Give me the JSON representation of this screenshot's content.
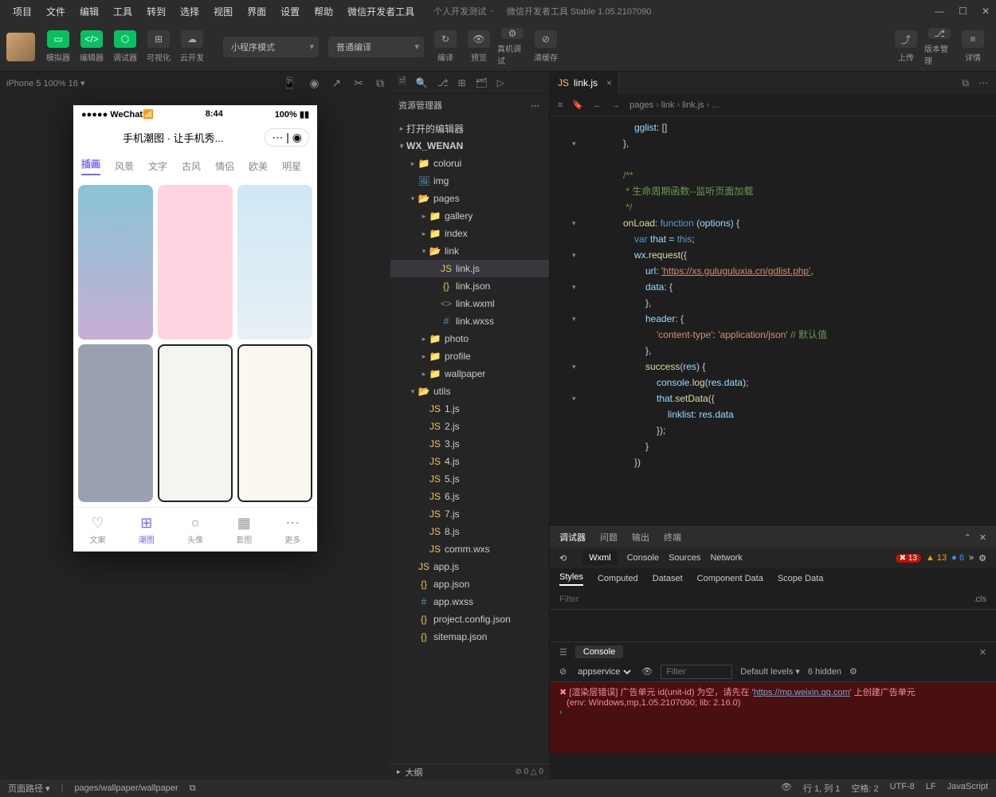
{
  "menu": [
    "项目",
    "文件",
    "编辑",
    "工具",
    "转到",
    "选择",
    "视图",
    "界面",
    "设置",
    "帮助",
    "微信开发者工具"
  ],
  "title": "个人开发测试",
  "title2": "微信开发者工具 Stable 1.05.2107090",
  "toolbar": {
    "sim": "模拟器",
    "editor": "编辑器",
    "debug": "调试器",
    "vis": "可视化",
    "cloud": "云开发",
    "mode": "小程序模式",
    "compile_mode": "普通编译",
    "compile": "编译",
    "preview": "预览",
    "remote": "真机调试",
    "clear": "清缓存",
    "upload": "上传",
    "ver": "版本管理",
    "detail": "详情"
  },
  "simbar": "iPhone 5 100% 16 ▾",
  "phone": {
    "carrier": "●●●●● WeChat📶",
    "time": "8:44",
    "bat": "100%",
    "title": "手机潮图 · 让手机秀...",
    "tabs": [
      "插画",
      "风景",
      "文字",
      "古风",
      "情侣",
      "欧美",
      "明星"
    ],
    "bottom": [
      "文案",
      "潮图",
      "头像",
      "套图",
      "更多"
    ]
  },
  "explorer": {
    "title": "资源管理器",
    "open": "打开的编辑器",
    "proj": "WX_WENAN",
    "items": [
      {
        "d": 1,
        "t": "folder",
        "n": "colorui"
      },
      {
        "d": 1,
        "t": "img",
        "n": "img"
      },
      {
        "d": 1,
        "t": "folder-o",
        "n": "pages",
        "open": true
      },
      {
        "d": 2,
        "t": "folder",
        "n": "gallery"
      },
      {
        "d": 2,
        "t": "folder",
        "n": "index"
      },
      {
        "d": 2,
        "t": "folder-o",
        "n": "link",
        "open": true
      },
      {
        "d": 3,
        "t": "js",
        "n": "link.js",
        "sel": true
      },
      {
        "d": 3,
        "t": "json",
        "n": "link.json"
      },
      {
        "d": 3,
        "t": "wxml",
        "n": "link.wxml"
      },
      {
        "d": 3,
        "t": "wxss",
        "n": "link.wxss"
      },
      {
        "d": 2,
        "t": "folder",
        "n": "photo"
      },
      {
        "d": 2,
        "t": "folder",
        "n": "profile"
      },
      {
        "d": 2,
        "t": "folder",
        "n": "wallpaper"
      },
      {
        "d": 1,
        "t": "folder-o",
        "n": "utils",
        "open": true
      },
      {
        "d": 2,
        "t": "js",
        "n": "1.js"
      },
      {
        "d": 2,
        "t": "js",
        "n": "2.js"
      },
      {
        "d": 2,
        "t": "js",
        "n": "3.js"
      },
      {
        "d": 2,
        "t": "js",
        "n": "4.js"
      },
      {
        "d": 2,
        "t": "js",
        "n": "5.js"
      },
      {
        "d": 2,
        "t": "js",
        "n": "6.js"
      },
      {
        "d": 2,
        "t": "js",
        "n": "7.js"
      },
      {
        "d": 2,
        "t": "js",
        "n": "8.js"
      },
      {
        "d": 2,
        "t": "wxs",
        "n": "comm.wxs"
      },
      {
        "d": 1,
        "t": "js",
        "n": "app.js"
      },
      {
        "d": 1,
        "t": "json",
        "n": "app.json"
      },
      {
        "d": 1,
        "t": "wxss",
        "n": "app.wxss"
      },
      {
        "d": 1,
        "t": "json",
        "n": "project.config.json"
      },
      {
        "d": 1,
        "t": "json",
        "n": "sitemap.json"
      }
    ]
  },
  "outline": "大纲",
  "outline_stat": "⊘ 0 △ 0",
  "editor": {
    "tab": "link.js",
    "crumb": [
      "pages",
      "link",
      "link.js",
      "..."
    ],
    "code": [
      {
        "i": 4,
        "t": "gglist: []",
        "seg": [
          {
            "c": "k5",
            "t": "gglist"
          },
          {
            "t": ": []"
          }
        ]
      },
      {
        "i": 3,
        "t": "},",
        "f": "▾"
      },
      {
        "i": 0,
        "t": ""
      },
      {
        "i": 3,
        "t": "/**",
        "c": "k4"
      },
      {
        "i": 3,
        "t": " * 生命周期函数--监听页面加载",
        "c": "k4"
      },
      {
        "i": 3,
        "t": " */",
        "c": "k4"
      },
      {
        "i": 3,
        "f": "▾",
        "seg": [
          {
            "c": "k6",
            "t": "onLoad"
          },
          {
            "t": ": "
          },
          {
            "c": "k1",
            "t": "function"
          },
          {
            "t": " ("
          },
          {
            "c": "k5",
            "t": "options"
          },
          {
            "t": ") {"
          }
        ]
      },
      {
        "i": 4,
        "seg": [
          {
            "c": "k1",
            "t": "var"
          },
          {
            "t": " "
          },
          {
            "c": "k5",
            "t": "that"
          },
          {
            "t": " = "
          },
          {
            "c": "k1",
            "t": "this"
          },
          {
            "t": ";"
          }
        ]
      },
      {
        "i": 4,
        "f": "▾",
        "seg": [
          {
            "c": "k5",
            "t": "wx"
          },
          {
            "t": "."
          },
          {
            "c": "k6",
            "t": "request"
          },
          {
            "t": "({"
          }
        ]
      },
      {
        "i": 5,
        "seg": [
          {
            "c": "k5",
            "t": "url"
          },
          {
            "t": ": "
          },
          {
            "c": "k3",
            "t": "'https://xs.guluguluxia.cn/gdlist.php'",
            "u": true
          },
          {
            "t": ","
          }
        ]
      },
      {
        "i": 5,
        "f": "▾",
        "seg": [
          {
            "c": "k5",
            "t": "data"
          },
          {
            "t": ": {"
          }
        ]
      },
      {
        "i": 5,
        "t": "},"
      },
      {
        "i": 5,
        "f": "▾",
        "seg": [
          {
            "c": "k5",
            "t": "header"
          },
          {
            "t": ": {"
          }
        ]
      },
      {
        "i": 6,
        "seg": [
          {
            "c": "k3",
            "t": "'content-type'"
          },
          {
            "t": ": "
          },
          {
            "c": "k3",
            "t": "'application/json'"
          },
          {
            "t": " "
          },
          {
            "c": "k4",
            "t": "// 默认值"
          }
        ]
      },
      {
        "i": 5,
        "t": "},"
      },
      {
        "i": 5,
        "f": "▾",
        "seg": [
          {
            "c": "k6",
            "t": "success"
          },
          {
            "t": "("
          },
          {
            "c": "k5",
            "t": "res"
          },
          {
            "t": ") {"
          }
        ]
      },
      {
        "i": 6,
        "seg": [
          {
            "c": "k5",
            "t": "console"
          },
          {
            "t": "."
          },
          {
            "c": "k6",
            "t": "log"
          },
          {
            "t": "("
          },
          {
            "c": "k5",
            "t": "res"
          },
          {
            "t": "."
          },
          {
            "c": "k5",
            "t": "data"
          },
          {
            "t": ");"
          }
        ]
      },
      {
        "i": 6,
        "f": "▾",
        "seg": [
          {
            "c": "k5",
            "t": "that"
          },
          {
            "t": "."
          },
          {
            "c": "k6",
            "t": "setData"
          },
          {
            "t": "({"
          }
        ]
      },
      {
        "i": 7,
        "seg": [
          {
            "c": "k5",
            "t": "linklist"
          },
          {
            "t": ": "
          },
          {
            "c": "k5",
            "t": "res"
          },
          {
            "t": "."
          },
          {
            "c": "k5",
            "t": "data"
          }
        ]
      },
      {
        "i": 6,
        "t": "});"
      },
      {
        "i": 5,
        "t": "}"
      },
      {
        "i": 4,
        "t": "})"
      }
    ]
  },
  "debug": {
    "top": [
      "调试器",
      "问题",
      "输出",
      "终端"
    ],
    "sub": [
      "Wxml",
      "Console",
      "Sources",
      "Network"
    ],
    "err_r": "13",
    "err_y": "13",
    "err_b": "6",
    "styles": [
      "Styles",
      "Computed",
      "Dataset",
      "Component Data",
      "Scope Data"
    ],
    "filter": "Filter",
    "cls": ".cls",
    "con_title": "Console",
    "scope": "appservice",
    "filter2": "Filter",
    "levels": "Default levels ▾",
    "hidden": "6 hidden",
    "log1": "[渲染层错误] 广告单元 id(unit-id) 为空，请先在 '",
    "log1_link": "https://mp.weixin.qq.com",
    "log1_end": "' 上创建广告单元",
    "log2": "(env: Windows,mp,1.05.2107090; lib: 2.16.0)"
  },
  "status": {
    "path_l": "页面路径 ▾",
    "path": "pages/wallpaper/wallpaper",
    "line": "行 1, 列 1",
    "space": "空格: 2",
    "enc": "UTF-8",
    "eol": "LF",
    "lang": "JavaScript"
  }
}
